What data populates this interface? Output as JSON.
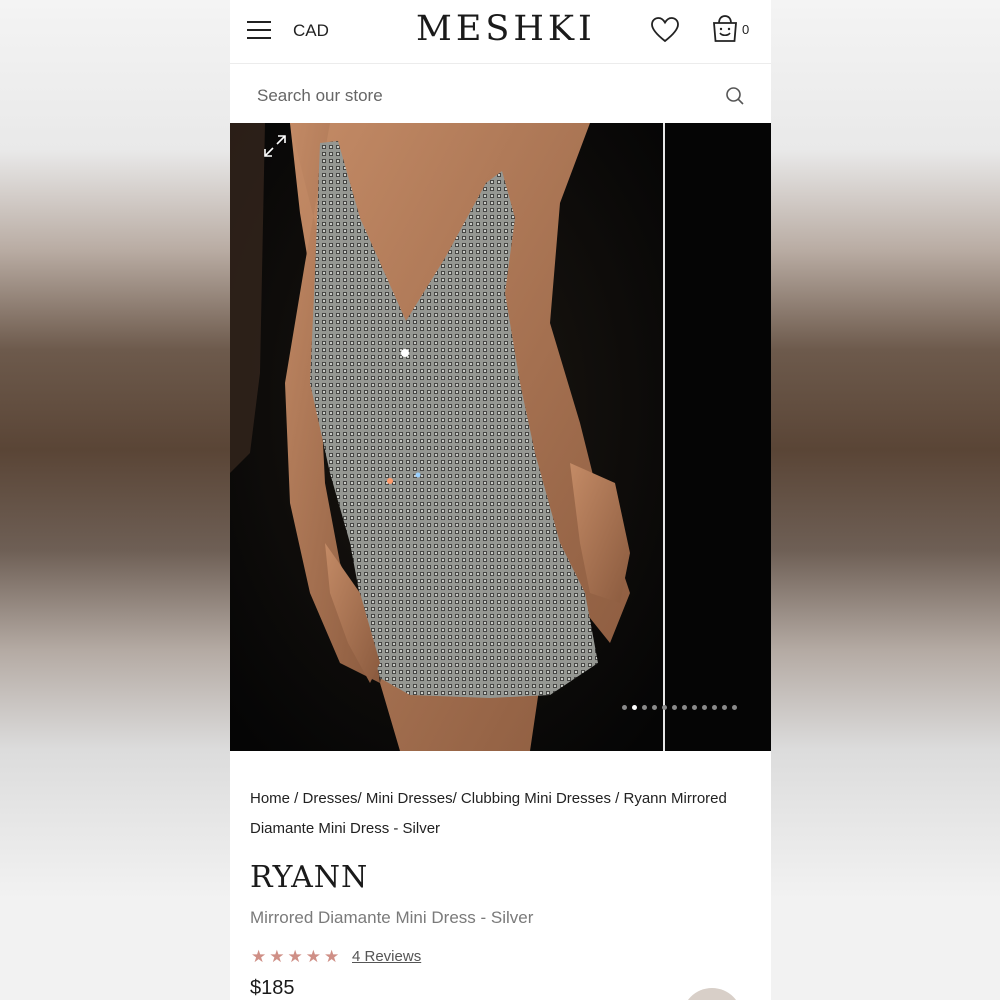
{
  "header": {
    "currency": "CAD",
    "logo": "MESHKI",
    "cart_count": "0",
    "icons": [
      "hamburger-icon",
      "heart-icon",
      "cart-icon"
    ]
  },
  "search": {
    "placeholder": "Search our store",
    "icon": "search-icon"
  },
  "gallery": {
    "image_description_icon": "expand-icon",
    "dot_count": 12,
    "active_dot": 1
  },
  "breadcrumb": {
    "home": "Home",
    "sep1": " / ",
    "dresses": "Dresses",
    "sep2": "/ ",
    "mini": "Mini Dresses",
    "sep3": "/ ",
    "clubbing": "Clubbing Mini Dresses",
    "sep4": " / ",
    "current": "Ryann Mirrored Diamante Mini Dress - Silver"
  },
  "product": {
    "name": "RYANN",
    "subtitle": "Mirrored Diamante Mini Dress - Silver",
    "rating": 5,
    "reviews": "4 Reviews",
    "price": "$185"
  },
  "colors": {
    "star": "#cf8f86",
    "text": "#1a1a1a",
    "muted": "#7a7a7a"
  }
}
